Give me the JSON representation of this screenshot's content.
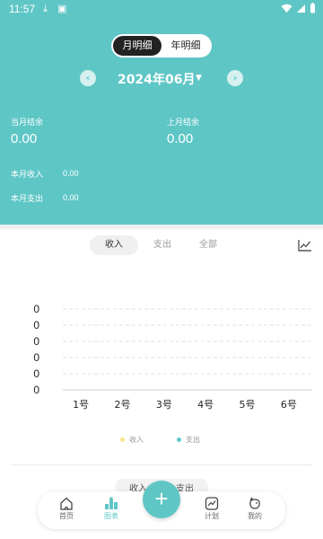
{
  "status_bar": {
    "time": "11:57"
  },
  "header": {
    "segment": {
      "options": [
        "月明细",
        "年明细"
      ],
      "active_index": 0
    },
    "month": {
      "title": "2024年06月"
    },
    "current_balance": {
      "label": "当月结余",
      "value": "0.00"
    },
    "last_balance": {
      "label": "上月结余",
      "value": "0.00"
    },
    "month_income": {
      "label": "本月收入",
      "value": "0.00"
    },
    "month_expense": {
      "label": "本月支出",
      "value": "0.00"
    }
  },
  "type_tabs": {
    "items": [
      "收入",
      "支出",
      "全部"
    ],
    "active_index": 0
  },
  "chart_data": {
    "type": "line",
    "categories": [
      "1号",
      "2号",
      "3号",
      "4号",
      "5号",
      "6号"
    ],
    "y_tick_labels": [
      "0",
      "0",
      "0",
      "0",
      "0",
      "0"
    ],
    "series": [
      {
        "name": "收入",
        "values": [
          0,
          0,
          0,
          0,
          0,
          0
        ],
        "color": "#f7e48c"
      },
      {
        "name": "支出",
        "values": [
          0,
          0,
          0,
          0,
          0,
          0
        ],
        "color": "#5fc6c6"
      }
    ],
    "ylim": [
      0,
      0
    ],
    "grid": true,
    "legend": "bottom"
  },
  "ghost_tabs": {
    "items": [
      "收入",
      "支出"
    ]
  },
  "bottom_nav": {
    "items": [
      {
        "label": "首页",
        "icon": "home-icon"
      },
      {
        "label": "图表",
        "icon": "chart-icon",
        "active": true
      },
      {
        "label": "计划",
        "icon": "plan-icon"
      },
      {
        "label": "我的",
        "icon": "profile-icon"
      }
    ],
    "fab_label": "+"
  },
  "colors": {
    "accent": "#5fc6c6",
    "income_dot": "#f7e48c",
    "expense_dot": "#5fc6c6"
  }
}
